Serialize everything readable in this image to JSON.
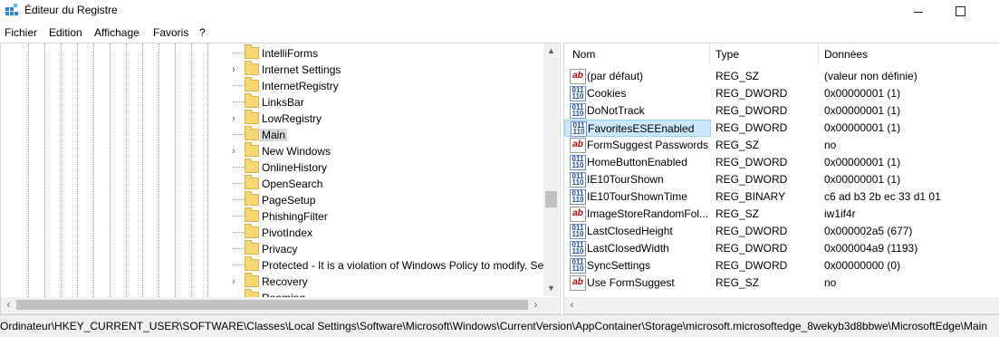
{
  "window": {
    "title": "Éditeur du Registre",
    "minimize": "—",
    "maximize": "☐"
  },
  "menu": [
    "Fichier",
    "Edition",
    "Affichage",
    "Favoris",
    "?"
  ],
  "tree": {
    "items": [
      {
        "label": "IntelliForms",
        "expandable": false
      },
      {
        "label": "Internet Settings",
        "expandable": true
      },
      {
        "label": "InternetRegistry",
        "expandable": false
      },
      {
        "label": "LinksBar",
        "expandable": false
      },
      {
        "label": "LowRegistry",
        "expandable": true
      },
      {
        "label": "Main",
        "expandable": false,
        "selected": true
      },
      {
        "label": "New Windows",
        "expandable": true
      },
      {
        "label": "OnlineHistory",
        "expandable": false
      },
      {
        "label": "OpenSearch",
        "expandable": false
      },
      {
        "label": "PageSetup",
        "expandable": false
      },
      {
        "label": "PhishingFilter",
        "expandable": false
      },
      {
        "label": "PivotIndex",
        "expandable": false
      },
      {
        "label": "Privacy",
        "expandable": false
      },
      {
        "label": "Protected - It is a violation of Windows Policy to modify. Se",
        "expandable": false
      },
      {
        "label": "Recovery",
        "expandable": true
      },
      {
        "label": "Roaming",
        "expandable": false
      }
    ]
  },
  "values": {
    "columns": {
      "name": "Nom",
      "type": "Type",
      "data": "Données"
    },
    "rows": [
      {
        "kind": "sz",
        "name": "(par défaut)",
        "type": "REG_SZ",
        "data": "(valeur non définie)"
      },
      {
        "kind": "dw",
        "name": "Cookies",
        "type": "REG_DWORD",
        "data": "0x00000001 (1)"
      },
      {
        "kind": "dw",
        "name": "DoNotTrack",
        "type": "REG_DWORD",
        "data": "0x00000001 (1)"
      },
      {
        "kind": "dw",
        "name": "FavoritesESEEnabled",
        "type": "REG_DWORD",
        "data": "0x00000001 (1)",
        "selected": true
      },
      {
        "kind": "sz",
        "name": "FormSuggest Passwords",
        "type": "REG_SZ",
        "data": "no"
      },
      {
        "kind": "dw",
        "name": "HomeButtonEnabled",
        "type": "REG_DWORD",
        "data": "0x00000001 (1)"
      },
      {
        "kind": "dw",
        "name": "IE10TourShown",
        "type": "REG_DWORD",
        "data": "0x00000001 (1)"
      },
      {
        "kind": "dw",
        "name": "IE10TourShownTime",
        "type": "REG_BINARY",
        "data": "c6 ad b3 2b ec 33 d1 01"
      },
      {
        "kind": "sz",
        "name": "ImageStoreRandomFol...",
        "type": "REG_SZ",
        "data": "iw1if4r"
      },
      {
        "kind": "dw",
        "name": "LastClosedHeight",
        "type": "REG_DWORD",
        "data": "0x000002a5 (677)"
      },
      {
        "kind": "dw",
        "name": "LastClosedWidth",
        "type": "REG_DWORD",
        "data": "0x000004a9 (1193)"
      },
      {
        "kind": "dw",
        "name": "SyncSettings",
        "type": "REG_DWORD",
        "data": "0x00000000 (0)"
      },
      {
        "kind": "sz",
        "name": "Use FormSuggest",
        "type": "REG_SZ",
        "data": "no"
      }
    ]
  },
  "icons": {
    "sz": "ab",
    "dw": "011\n110"
  },
  "status": {
    "path": "Ordinateur\\HKEY_CURRENT_USER\\SOFTWARE\\Classes\\Local Settings\\Software\\Microsoft\\Windows\\CurrentVersion\\AppContainer\\Storage\\microsoft.microsoftedge_8wekyb3d8bbwe\\MicrosoftEdge\\Main"
  }
}
